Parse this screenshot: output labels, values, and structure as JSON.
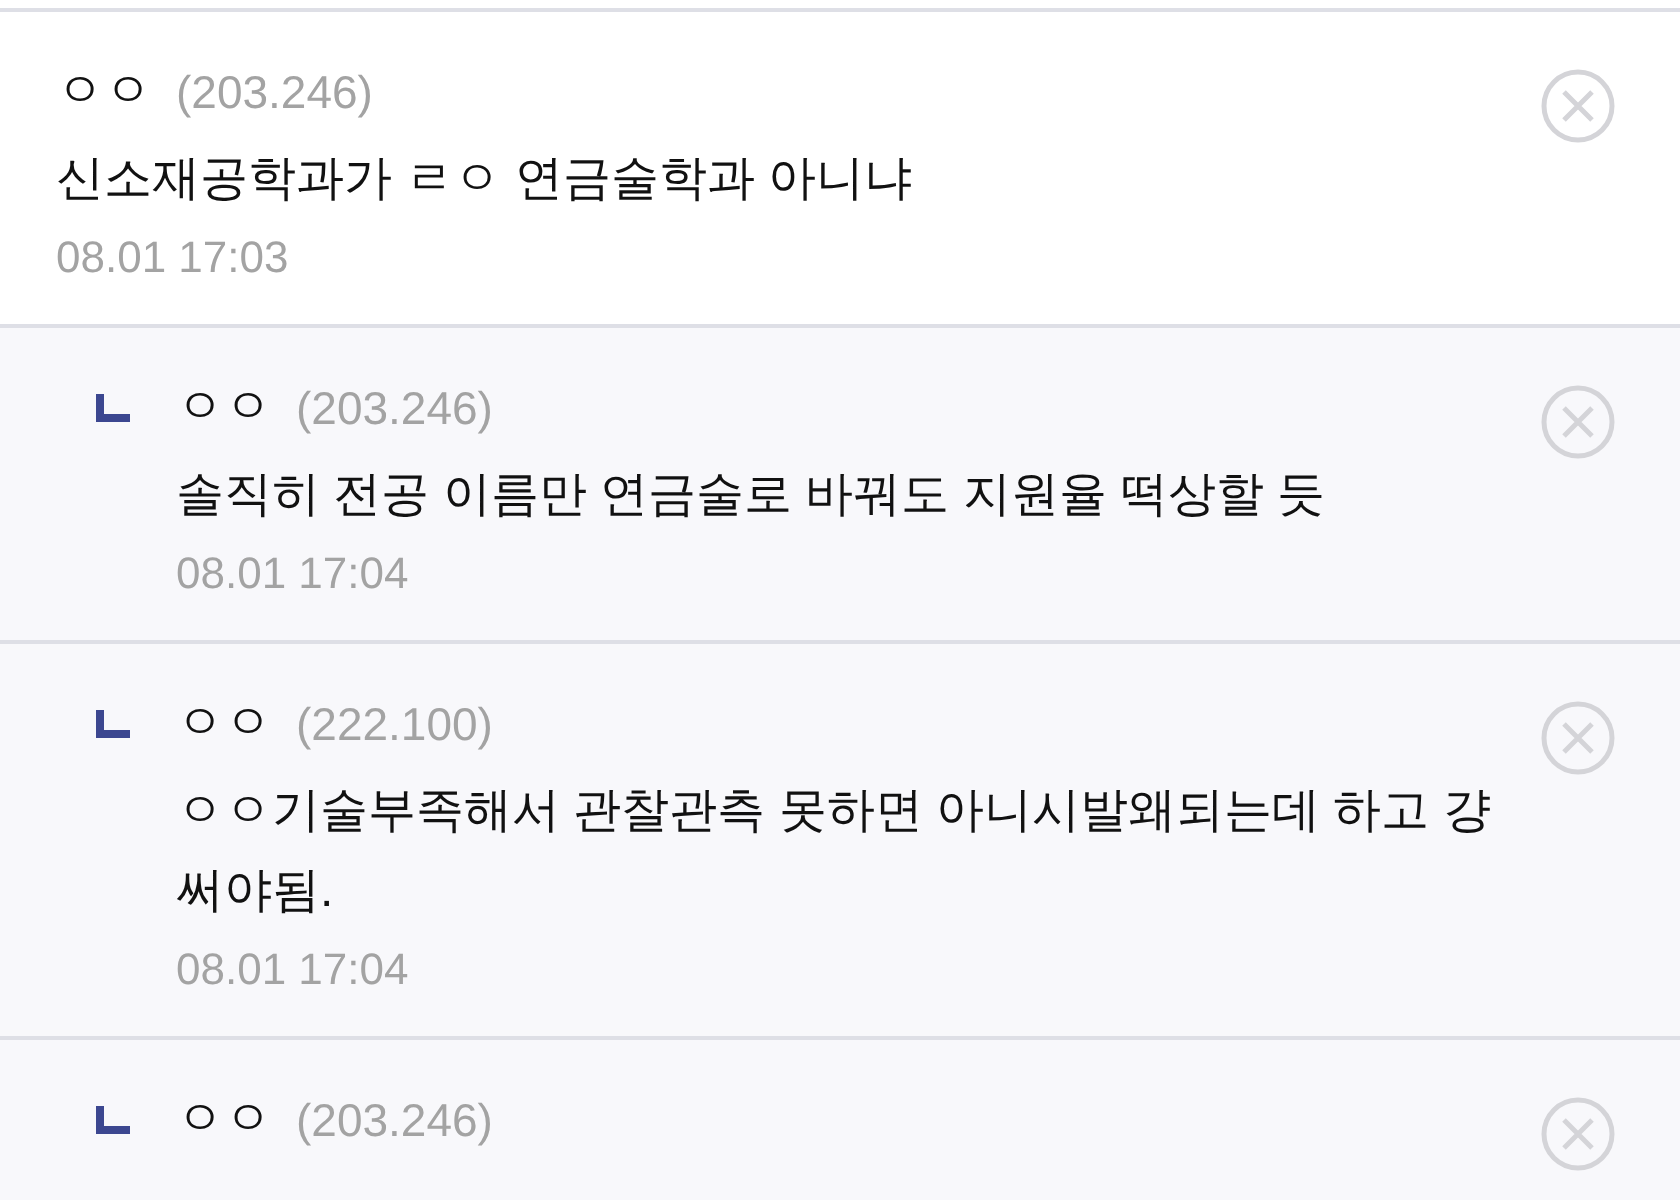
{
  "comments": [
    {
      "kind": "comment",
      "nickname": "ㅇㅇ",
      "ip": "(203.246)",
      "text": "신소재공학과가 ㄹㅇ 연금술학과 아니냐",
      "time": "08.01 17:03"
    },
    {
      "kind": "reply",
      "nickname": "ㅇㅇ",
      "ip": "(203.246)",
      "text": "솔직히 전공 이름만 연금술로 바꿔도 지원율 떡상할 듯",
      "time": "08.01 17:04"
    },
    {
      "kind": "reply",
      "nickname": "ㅇㅇ",
      "ip": "(222.100)",
      "text": "ㅇㅇ기술부족해서 관찰관측 못하면 아니시발왜되는데 하고 걍 써야됨.",
      "time": "08.01 17:04"
    },
    {
      "kind": "reply",
      "nickname": "ㅇㅇ",
      "ip": "(203.246)"
    }
  ]
}
